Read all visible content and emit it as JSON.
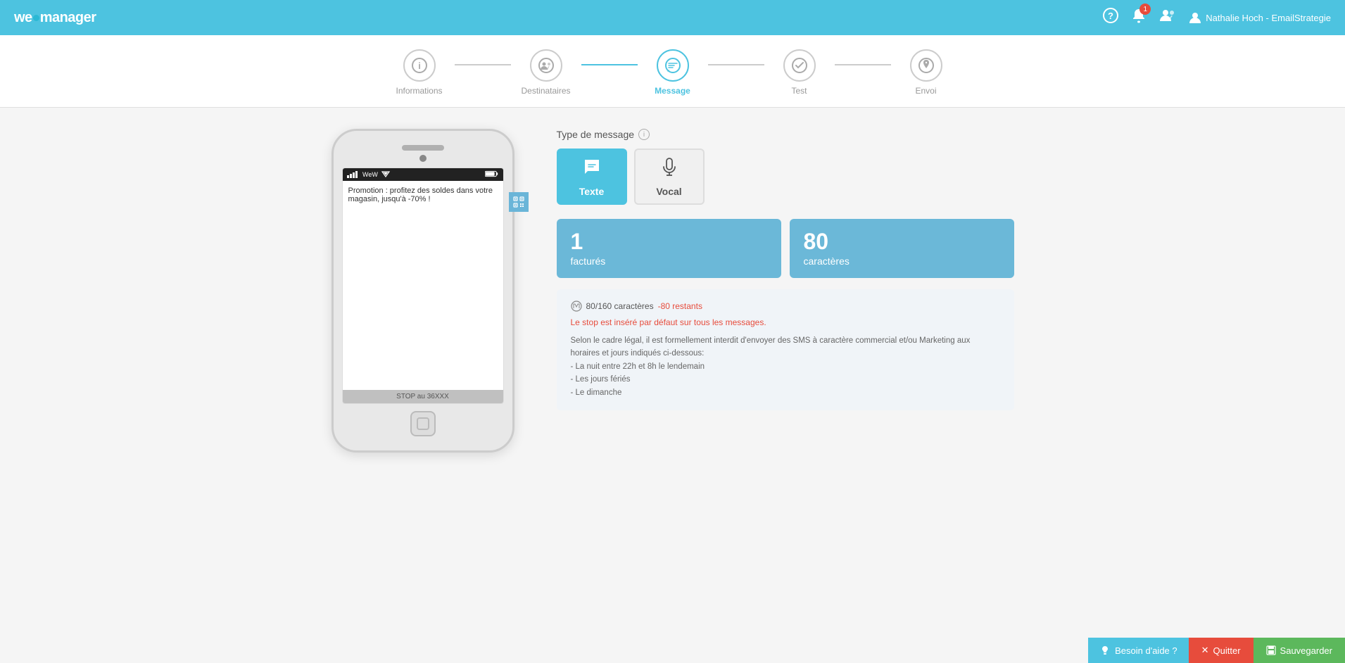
{
  "header": {
    "logo": "wewmanager",
    "logo_we": "we",
    "logo_w": "w",
    "logo_manager": "manager",
    "help_icon": "?",
    "notification_count": "1",
    "users_icon": "users",
    "user_label": "Nathalie Hoch - EmailStrategie"
  },
  "wizard": {
    "steps": [
      {
        "id": "informations",
        "label": "Informations",
        "icon": "info",
        "state": "done"
      },
      {
        "id": "destinataires",
        "label": "Destinataires",
        "icon": "group",
        "state": "done"
      },
      {
        "id": "message",
        "label": "Message",
        "icon": "chat",
        "state": "active"
      },
      {
        "id": "test",
        "label": "Test",
        "icon": "check",
        "state": "inactive"
      },
      {
        "id": "envoi",
        "label": "Envoi",
        "icon": "rocket",
        "state": "inactive"
      }
    ]
  },
  "message_type": {
    "label": "Type de message",
    "texte_label": "Texte",
    "vocal_label": "Vocal"
  },
  "phone": {
    "status_bar_left": "WeW",
    "message_text": "Promotion : profitez des soldes dans votre magasin, jusqu'à -70% !",
    "stop_text": "STOP au 36XXX"
  },
  "stats": {
    "sms_count": "1",
    "sms_label": "facturés",
    "char_count": "80",
    "char_label": "caractères"
  },
  "char_info": {
    "current": "80",
    "max": "160",
    "remaining_label": "-80 restants"
  },
  "warnings": {
    "stop_message": "Le stop est inséré par défaut sur tous les messages.",
    "legal_intro": "Selon le cadre légal, il est formellement interdit d'envoyer des SMS à caractère commercial et/ou Marketing aux horaires et jours indiqués ci-dessous:",
    "legal_item1": "- La nuit entre 22h et 8h le lendemain",
    "legal_item2": "- Les jours fériés",
    "legal_item3": "- Le dimanche"
  },
  "bottom": {
    "help_label": "Besoin d'aide ?",
    "quit_label": "Quitter",
    "save_label": "Sauvegarder"
  }
}
